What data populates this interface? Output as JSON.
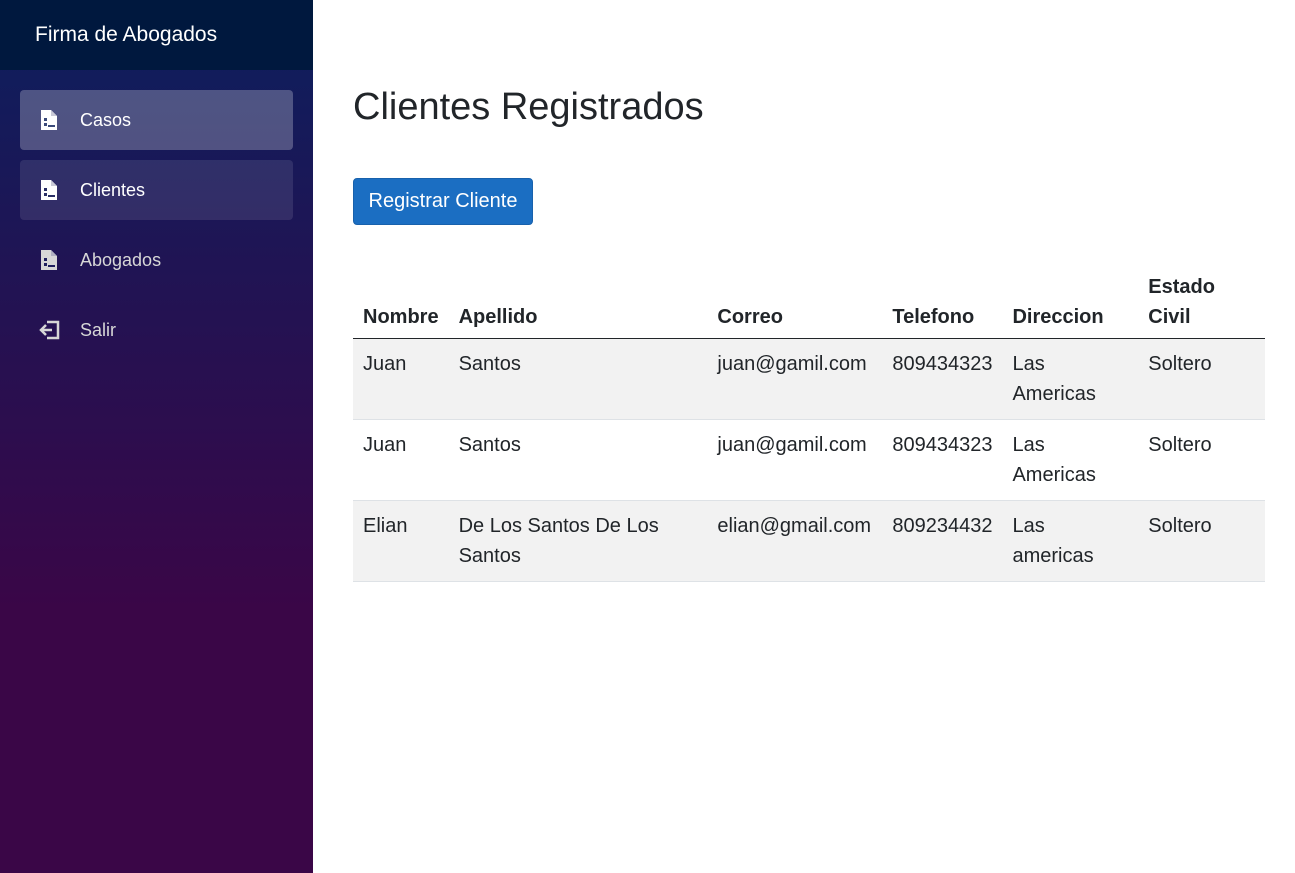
{
  "sidebar": {
    "brand": "Firma de Abogados",
    "items": [
      {
        "label": "Casos",
        "icon": "document-icon"
      },
      {
        "label": "Clientes",
        "icon": "document-icon"
      },
      {
        "label": "Abogados",
        "icon": "document-icon"
      },
      {
        "label": "Salir",
        "icon": "logout-icon"
      }
    ]
  },
  "main": {
    "title": "Clientes Registrados",
    "register_button": "Registrar Cliente",
    "table": {
      "headers": [
        "Nombre",
        "Apellido",
        "Correo",
        "Telefono",
        "Direccion",
        "Estado Civil"
      ],
      "rows": [
        [
          "Juan",
          "Santos",
          "juan@gamil.com",
          "809434323",
          "Las Americas",
          "Soltero"
        ],
        [
          "Juan",
          "Santos",
          "juan@gamil.com",
          "809434323",
          "Las Americas",
          "Soltero"
        ],
        [
          "Elian",
          "De Los Santos De Los Santos",
          "elian@gmail.com",
          "809234432",
          "Las americas",
          "Soltero"
        ]
      ]
    }
  },
  "colors": {
    "brand_bar": "#00183e",
    "sidebar_top": "#0c1f5e",
    "sidebar_bottom": "#3a0647",
    "primary_button": "#1b6ec2",
    "striped_row": "#f2f2f2"
  }
}
